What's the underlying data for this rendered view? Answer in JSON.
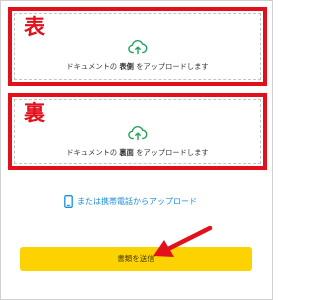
{
  "upload_front": {
    "side_label": "表",
    "text_prefix": "ドキュメントの ",
    "text_side": "表側",
    "text_suffix": " をアップロードします"
  },
  "upload_back": {
    "side_label": "裏",
    "text_prefix": "ドキュメントの ",
    "text_side": "裏面",
    "text_suffix": " をアップロードします"
  },
  "phone_upload": {
    "label": "または携帯電話からアップロード"
  },
  "submit": {
    "label": "書類を送信"
  },
  "icons": {
    "upload": "cloud-upload-icon",
    "phone": "mobile-phone-icon",
    "annotation": "red-arrow"
  },
  "colors": {
    "annotation_red": "#e3101b",
    "accent_green": "#22a05a",
    "link_blue": "#1a8fd8",
    "button_yellow": "#fcd200"
  }
}
